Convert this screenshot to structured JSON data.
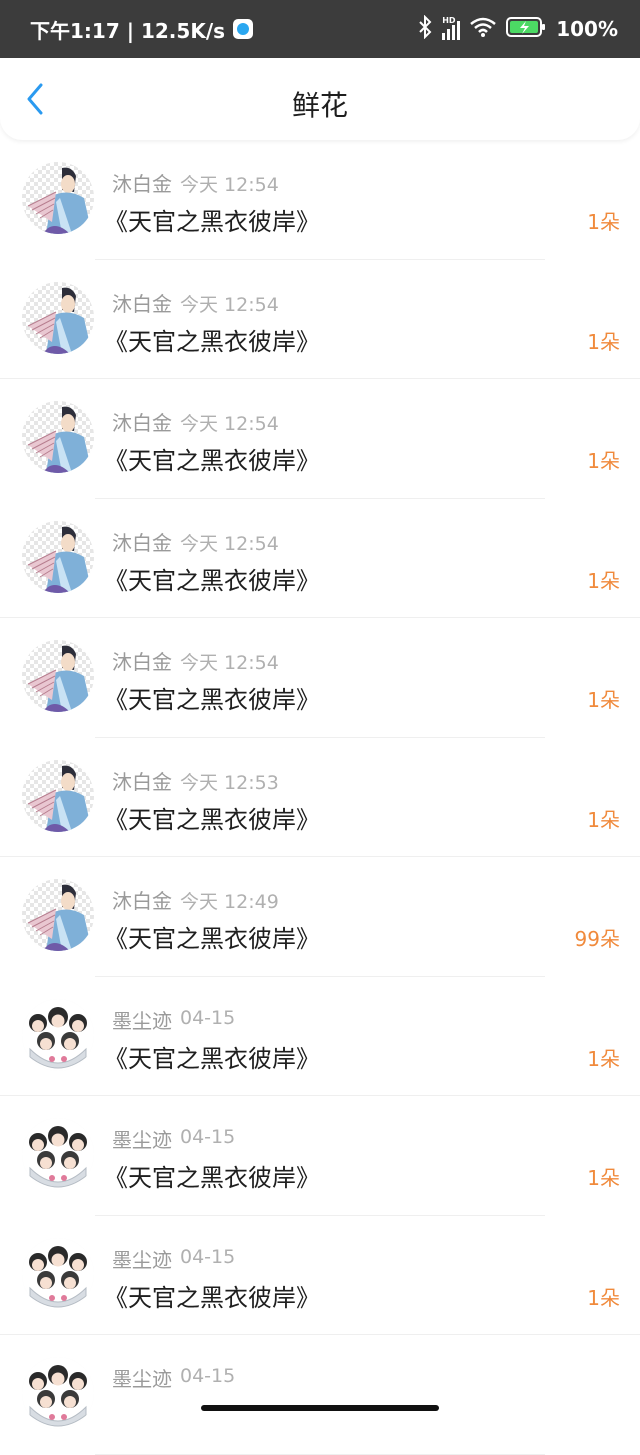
{
  "status_bar": {
    "time_speed": "下午1:17 | 12.5K/s",
    "hd_label": "HD",
    "battery": "100%"
  },
  "header": {
    "title": "鲜花"
  },
  "colors": {
    "accent_blue": "#2a9af0",
    "count_orange": "#f08a3c"
  },
  "gifts": [
    {
      "user": "沐白金",
      "time": "今天 12:54",
      "book": "《天官之黑衣彼岸》",
      "count": "1朵",
      "avatar": "fan-avatar"
    },
    {
      "user": "沐白金",
      "time": "今天 12:54",
      "book": "《天官之黑衣彼岸》",
      "count": "1朵",
      "avatar": "fan-avatar"
    },
    {
      "user": "沐白金",
      "time": "今天 12:54",
      "book": "《天官之黑衣彼岸》",
      "count": "1朵",
      "avatar": "fan-avatar"
    },
    {
      "user": "沐白金",
      "time": "今天 12:54",
      "book": "《天官之黑衣彼岸》",
      "count": "1朵",
      "avatar": "fan-avatar"
    },
    {
      "user": "沐白金",
      "time": "今天 12:54",
      "book": "《天官之黑衣彼岸》",
      "count": "1朵",
      "avatar": "fan-avatar"
    },
    {
      "user": "沐白金",
      "time": "今天 12:53",
      "book": "《天官之黑衣彼岸》",
      "count": "1朵",
      "avatar": "fan-avatar"
    },
    {
      "user": "沐白金",
      "time": "今天 12:49",
      "book": "《天官之黑衣彼岸》",
      "count": "99朵",
      "avatar": "fan-avatar"
    },
    {
      "user": "墨尘迹",
      "time": "04-15",
      "book": "《天官之黑衣彼岸》",
      "count": "1朵",
      "avatar": "group-avatar"
    },
    {
      "user": "墨尘迹",
      "time": "04-15",
      "book": "《天官之黑衣彼岸》",
      "count": "1朵",
      "avatar": "group-avatar"
    },
    {
      "user": "墨尘迹",
      "time": "04-15",
      "book": "《天官之黑衣彼岸》",
      "count": "1朵",
      "avatar": "group-avatar"
    },
    {
      "user": "墨尘迹",
      "time": "04-15",
      "book": "",
      "count": "",
      "avatar": "group-avatar"
    }
  ]
}
